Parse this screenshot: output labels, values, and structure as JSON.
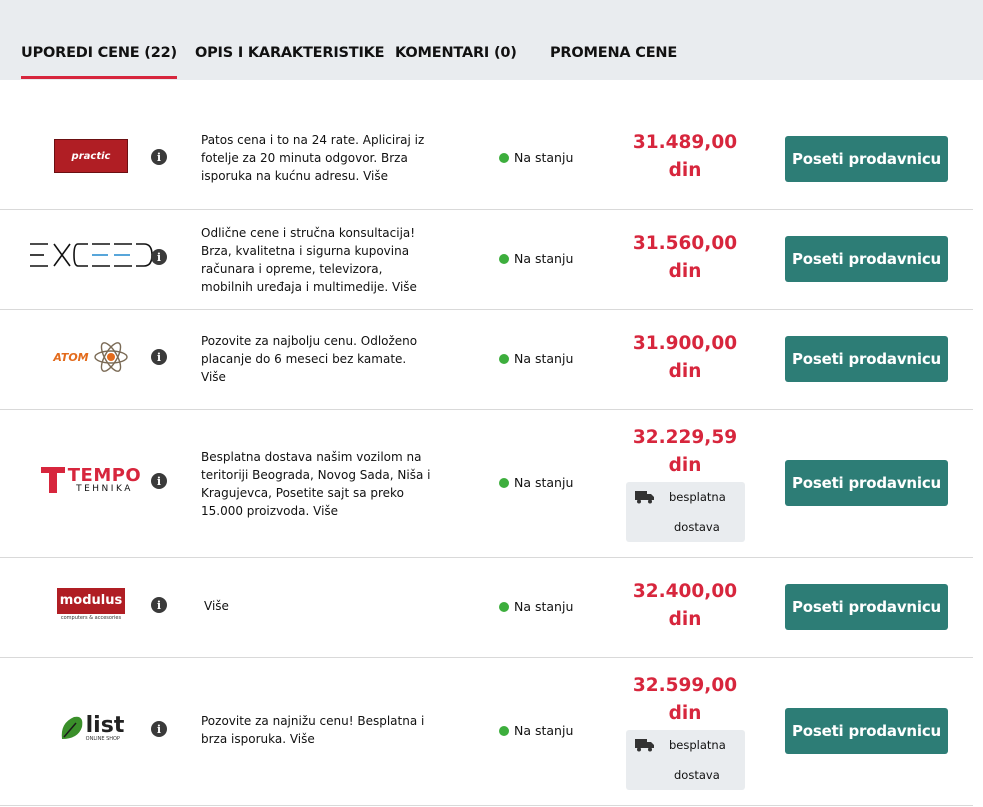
{
  "tabs": [
    {
      "label": "UPOREDI CENE (22)",
      "active": true
    },
    {
      "label": "OPIS I KARAKTERISTIKE",
      "active": false
    },
    {
      "label": "KOMENTARI (0)",
      "active": false
    },
    {
      "label": "PROMENA CENE",
      "active": false
    }
  ],
  "offers": [
    {
      "logo_text": "practic",
      "description": "Patos cena i to na 24 rate. Apliciraj iz fotelje za 20 minuta odgovor. Brza isporuka na kućnu adresu.",
      "more": "Više",
      "stock": "Na stanju",
      "price": "31.489,00",
      "currency": "din",
      "free_shipping": false,
      "button": "Poseti prodavnicu"
    },
    {
      "logo_text": "EXCEED",
      "description": "Odlične cene i stručna konsultacija! Brza, kvalitetna i sigurna kupovina računara i opreme, televizora, mobilnih uređaja i multimedije.",
      "more": "Više",
      "stock": "Na stanju",
      "price": "31.560,00",
      "currency": "din",
      "free_shipping": false,
      "button": "Poseti prodavnicu"
    },
    {
      "logo_text": "ATOM",
      "description": "Pozovite za najbolju cenu. Odloženo placanje do 6 meseci bez kamate.",
      "more": "Više",
      "stock": "Na stanju",
      "price": "31.900,00",
      "currency": "din",
      "free_shipping": false,
      "button": "Poseti prodavnicu"
    },
    {
      "logo_text": "TEMPO",
      "logo_sub": "TEHNIKA",
      "description": "Besplatna dostava našim vozilom na teritoriji Beograda, Novog Sada, Niša i Kragujevca, Posetite sajt sa preko 15.000 proizvoda.",
      "more": "Više",
      "stock": "Na stanju",
      "price": "32.229,59",
      "currency": "din",
      "free_shipping": true,
      "shipping_line1": "besplatna",
      "shipping_line2": "dostava",
      "button": "Poseti prodavnicu"
    },
    {
      "logo_text": "modulus",
      "logo_sub": "computers & accesories",
      "description": "",
      "more": "Više",
      "stock": "Na stanju",
      "price": "32.400,00",
      "currency": "din",
      "free_shipping": false,
      "button": "Poseti prodavnicu"
    },
    {
      "logo_text": "list",
      "logo_sub": "ONLINE SHOP",
      "description": "Pozovite za najnižu cenu! Besplatna i brza isporuka.",
      "more": "Više",
      "stock": "Na stanju",
      "price": "32.599,00",
      "currency": "din",
      "free_shipping": true,
      "shipping_line1": "besplatna",
      "shipping_line2": "dostava",
      "button": "Poseti prodavnicu"
    }
  ],
  "colors": {
    "accent": "#d7263d",
    "button": "#2d7d76",
    "in_stock": "#3dae3d"
  }
}
